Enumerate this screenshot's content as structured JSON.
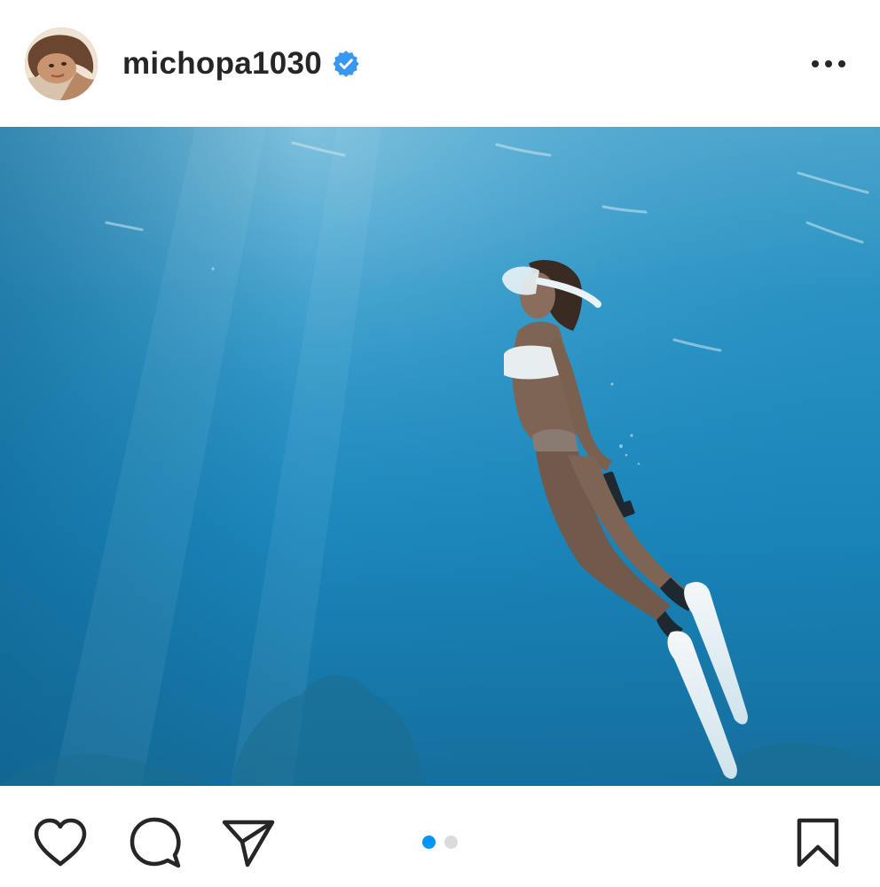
{
  "post": {
    "author": {
      "username": "michopa1030",
      "verified": true,
      "avatar_icon": "profile-photo"
    },
    "header_menu_icon": "more-horizontal-icon",
    "media": {
      "description_icon": "underwater-snorkeler-photo",
      "carousel_total": 2,
      "carousel_current": 1
    },
    "actions": {
      "like_icon": "heart-icon",
      "comment_icon": "comment-icon",
      "share_icon": "send-icon",
      "save_icon": "bookmark-icon"
    },
    "colors": {
      "text": "#262626",
      "verified": "#3897f0",
      "dot_active": "#0095f6",
      "dot_inactive": "#dbdbdb",
      "water": "#1f8ec0"
    }
  }
}
